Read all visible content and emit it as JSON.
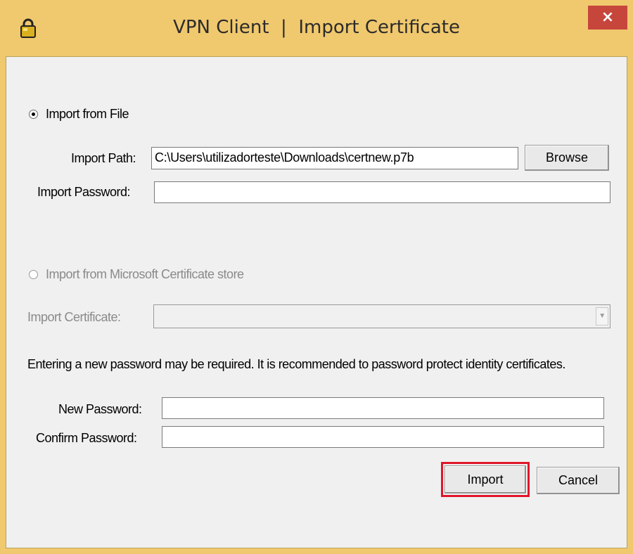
{
  "window": {
    "title": "VPN Client  |  Import Certificate",
    "close_glyph": "×",
    "icon": "padlock-icon"
  },
  "import_file": {
    "radio_label": "Import from File",
    "selected": true,
    "path_label": "Import Path:",
    "path_value": "C:\\Users\\utilizadorteste\\Downloads\\certnew.p7b",
    "browse_label": "Browse",
    "password_label": "Import Password:",
    "password_value": ""
  },
  "import_store": {
    "radio_label": "Import from Microsoft Certificate store",
    "selected": false,
    "certificate_label": "Import Certificate:",
    "certificate_value": ""
  },
  "new_password": {
    "info_text": "Entering a new password may be required.  It is recommended to password protect identity certificates.",
    "new_label": "New Password:",
    "confirm_label": "Confirm Password:",
    "new_value": "",
    "confirm_value": ""
  },
  "actions": {
    "import_label": "Import",
    "cancel_label": "Cancel",
    "highlight_color": "#e0162b"
  },
  "colors": {
    "titlebar": "#f0c86e",
    "close_button": "#c7463c"
  }
}
